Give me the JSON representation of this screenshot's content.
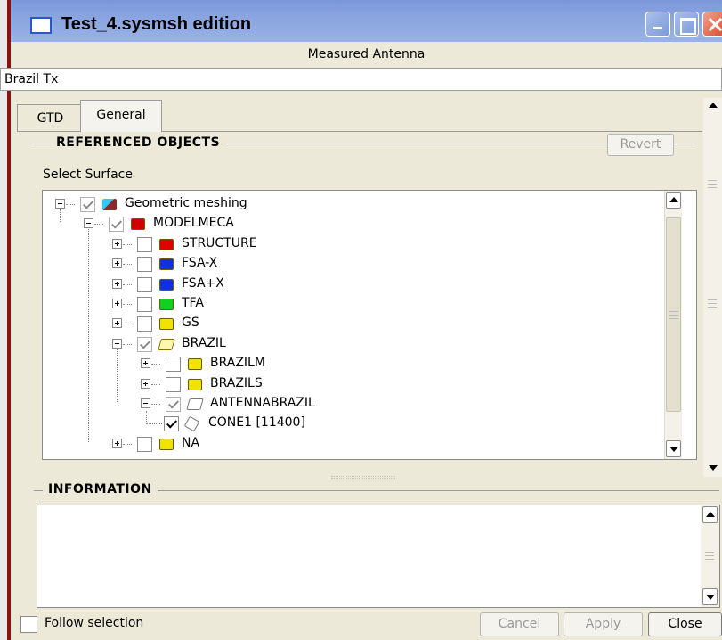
{
  "window": {
    "title": "Test_4.sysmsh edition",
    "subtitle": "Measured Antenna"
  },
  "name_field": {
    "value": "Brazil Tx"
  },
  "tabs": [
    {
      "label": "GTD",
      "active": false
    },
    {
      "label": "General",
      "active": true
    }
  ],
  "referenced_objects": {
    "title": "REFERENCED OBJECTS",
    "revert_label": "Revert",
    "select_label": "Select Surface"
  },
  "tree": {
    "items": [
      {
        "label": "Geometric meshing",
        "checked": true,
        "greyed": true,
        "icon": "mesh-icon",
        "color": "#8b2a2a"
      },
      {
        "label": "MODELMECA",
        "checked": true,
        "greyed": true,
        "icon": "folder-red-icon",
        "color": "#d00000"
      },
      {
        "label": "STRUCTURE",
        "checked": false,
        "greyed": false,
        "icon": "folder-red-icon",
        "color": "#e00000"
      },
      {
        "label": "FSA-X",
        "checked": false,
        "greyed": false,
        "icon": "folder-blue-icon",
        "color": "#1030e0"
      },
      {
        "label": "FSA+X",
        "checked": false,
        "greyed": false,
        "icon": "folder-blue-icon",
        "color": "#1030e0"
      },
      {
        "label": "TFA",
        "checked": false,
        "greyed": false,
        "icon": "folder-green-icon",
        "color": "#10d020"
      },
      {
        "label": "GS",
        "checked": false,
        "greyed": false,
        "icon": "folder-yellow-icon",
        "color": "#f2e200"
      },
      {
        "label": "BRAZIL",
        "checked": true,
        "greyed": true,
        "icon": "folder-open-icon",
        "color": "#f2e200"
      },
      {
        "label": "BRAZILM",
        "checked": false,
        "greyed": false,
        "icon": "folder-yellow-icon",
        "color": "#f2e200"
      },
      {
        "label": "BRAZILS",
        "checked": false,
        "greyed": false,
        "icon": "folder-yellow-icon",
        "color": "#f2e200"
      },
      {
        "label": "ANTENNABRAZIL",
        "checked": true,
        "greyed": true,
        "icon": "folder-open-grey-icon",
        "color": "#ffffff"
      },
      {
        "label": "CONE1 [11400]",
        "checked": true,
        "greyed": false,
        "icon": "cube-icon",
        "color": "#ffffff"
      },
      {
        "label": "NA",
        "checked": false,
        "greyed": false,
        "icon": "folder-yellow-icon",
        "color": "#f2e200"
      }
    ]
  },
  "information": {
    "title": "INFORMATION"
  },
  "footer": {
    "follow_label": "Follow selection",
    "cancel_label": "Cancel",
    "apply_label": "Apply",
    "close_label": "Close"
  }
}
